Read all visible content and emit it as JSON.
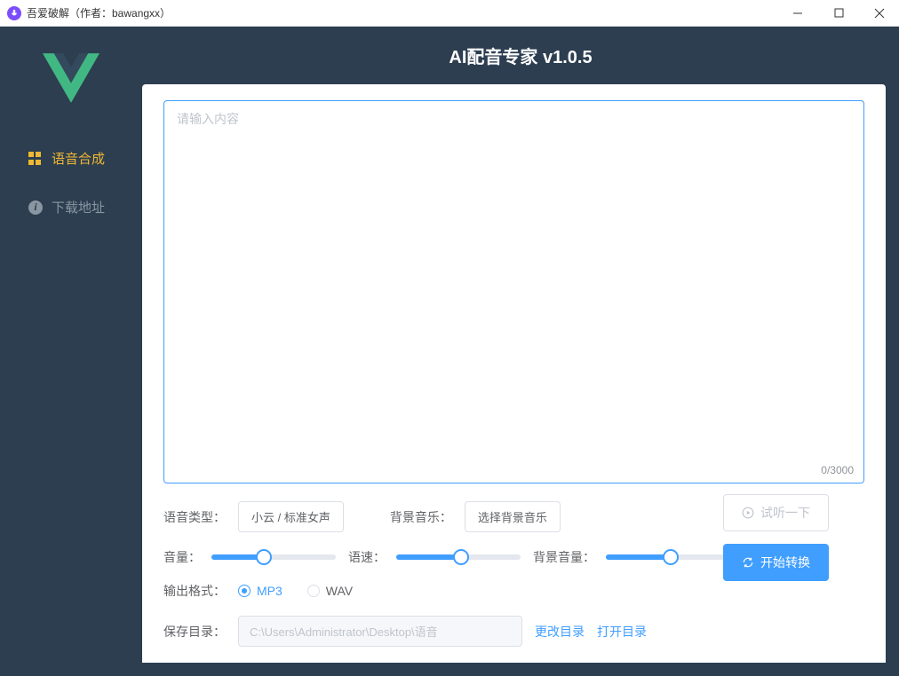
{
  "window": {
    "title": "吾爱破解（作者：bawangxx）"
  },
  "header": {
    "title": "AI配音专家 v1.0.5"
  },
  "sidebar": {
    "items": [
      {
        "label": "语音合成"
      },
      {
        "label": "下载地址"
      }
    ]
  },
  "editor": {
    "placeholder": "请输入内容",
    "char_count": "0/3000"
  },
  "controls": {
    "voice_type_label": "语音类型：",
    "voice_type_value": "小云 / 标准女声",
    "bg_music_label": "背景音乐：",
    "bg_music_value": "选择背景音乐",
    "volume_label": "音量：",
    "speed_label": "语速：",
    "bg_volume_label": "背景音量：",
    "volume_percent": 42,
    "speed_percent": 52,
    "bg_volume_percent": 52,
    "output_format_label": "输出格式：",
    "formats": {
      "mp3": "MP3",
      "wav": "WAV"
    },
    "save_dir_label": "保存目录：",
    "save_dir_value": "C:\\Users\\Administrator\\Desktop\\语音",
    "change_dir": "更改目录",
    "open_dir": "打开目录"
  },
  "actions": {
    "preview": "试听一下",
    "convert": "开始转换"
  }
}
